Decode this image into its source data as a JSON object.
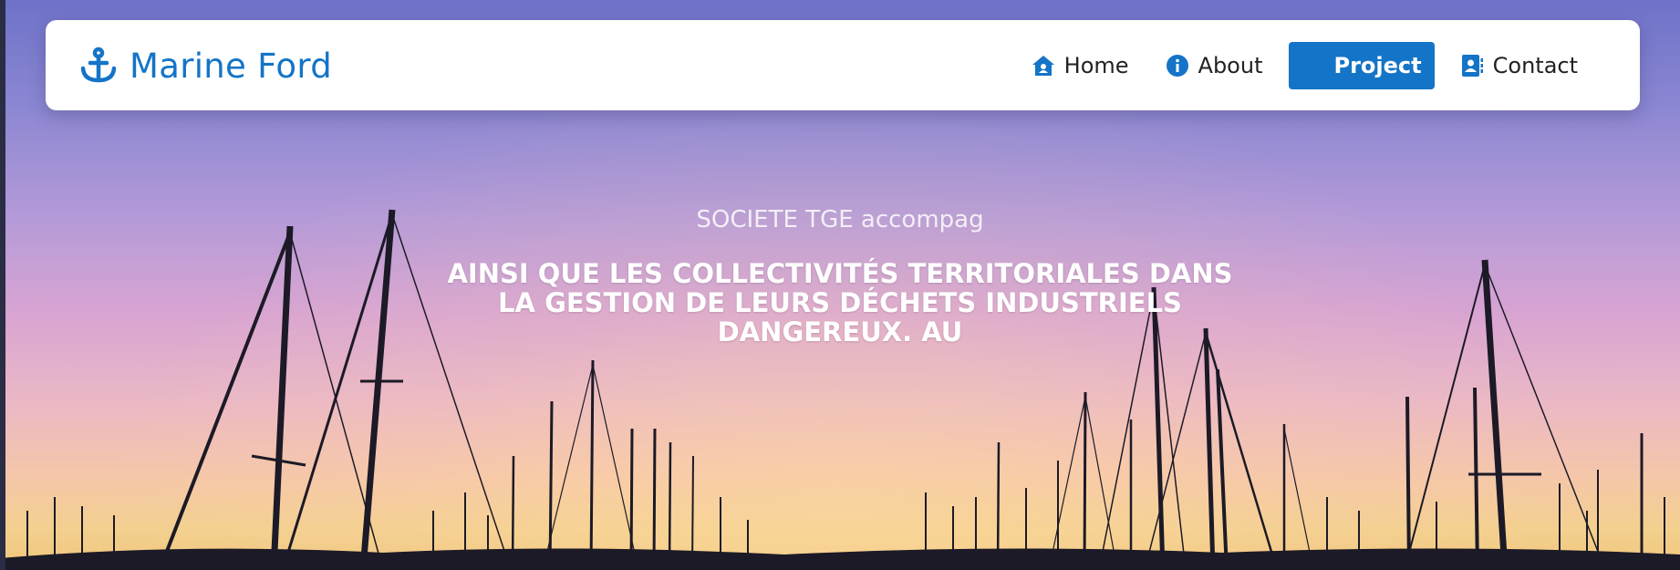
{
  "brand": {
    "name": "Marine Ford",
    "icon": "anchor-icon",
    "color": "#1474c7"
  },
  "nav": {
    "items": [
      {
        "label": "Home",
        "icon": "home-icon"
      },
      {
        "label": "About",
        "icon": "info-icon"
      },
      {
        "label": "Project",
        "icon": "project-icon",
        "active": true
      },
      {
        "label": "Contact",
        "icon": "contact-card-icon"
      }
    ],
    "active_color": "#1474c7"
  },
  "hero": {
    "subtitle": "SOCIETE TGE accompag",
    "headline": "AINSI QUE LES COLLECTIVITÉS TERRITORIALES DANS LA GESTION DE LEURS DÉCHETS INDUSTRIELS DANGEREUX. AU",
    "background": "sunset-marina-masts"
  }
}
